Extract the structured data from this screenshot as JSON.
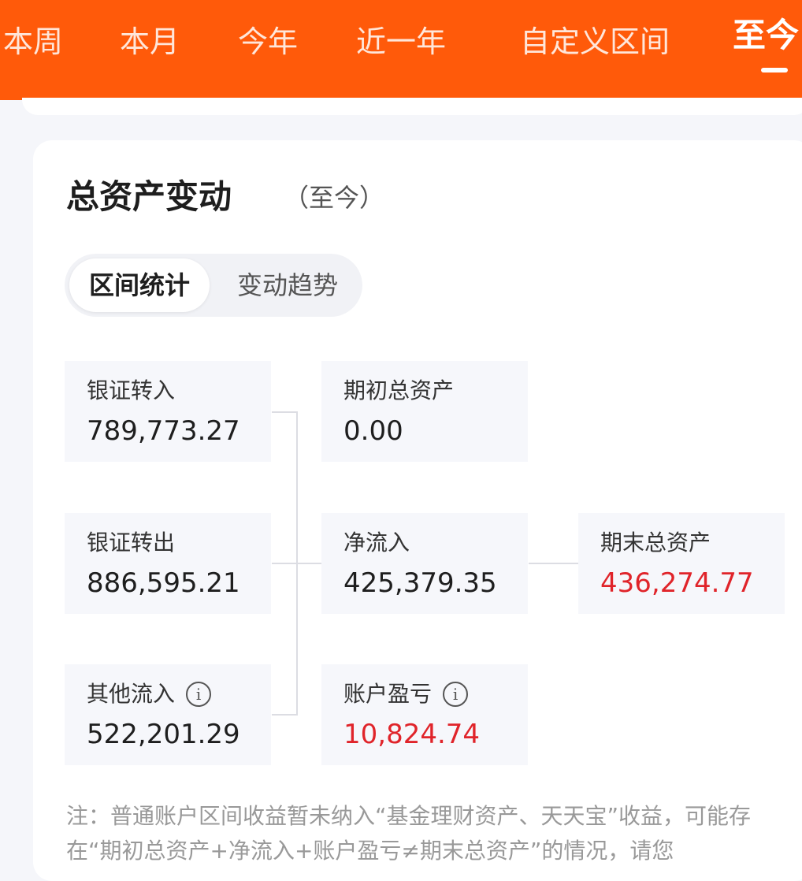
{
  "tabs": [
    {
      "label": "本周"
    },
    {
      "label": "本月"
    },
    {
      "label": "今年"
    },
    {
      "label": "近一年"
    },
    {
      "label": "自定义区间"
    },
    {
      "label": "至今"
    }
  ],
  "header": {
    "title": "总资产变动",
    "subtitle": "（至今）"
  },
  "segment": {
    "active": "区间统计",
    "inactive": "变动趋势"
  },
  "stats": {
    "bank_in": {
      "label": "银证转入",
      "value": "789,773.27"
    },
    "bank_out": {
      "label": "银证转出",
      "value": "886,595.21"
    },
    "other_in": {
      "label": "其他流入",
      "value": "522,201.29"
    },
    "start_assets": {
      "label": "期初总资产",
      "value": "0.00"
    },
    "net_inflow": {
      "label": "净流入",
      "value": "425,379.35"
    },
    "profit_loss": {
      "label": "账户盈亏",
      "value": "10,824.74"
    },
    "end_assets": {
      "label": "期末总资产",
      "value": "436,274.77"
    }
  },
  "info_glyph": "i",
  "note": "注：普通账户区间收益暂未纳入“基金理财资产、天天宝”收益，可能存在“期初总资产+净流入+账户盈亏≠期末总资产”的情况，请您",
  "colors": {
    "header_bg": "#ff5a0a",
    "negative_red": "#e0242a",
    "box_bg": "#f6f7fb"
  }
}
